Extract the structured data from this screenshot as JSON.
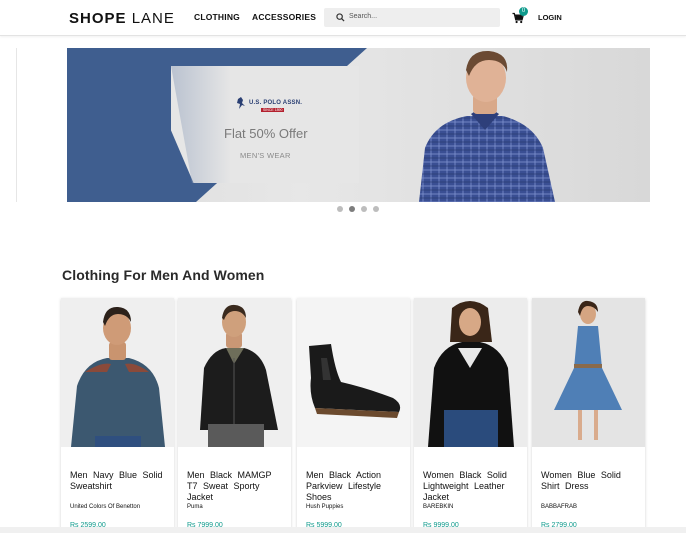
{
  "header": {
    "logo_bold": "SHOPE",
    "logo_light": "LANE",
    "nav": [
      "CLOTHING",
      "ACCESSORIES"
    ],
    "search_placeholder": "Search...",
    "cart_count": "0",
    "login": "LOGIN"
  },
  "banner": {
    "brand": "U.S. POLO ASSN.",
    "brand_since": "SINCE 1890",
    "offer": "Flat 50% Offer",
    "category": "MEN'S WEAR",
    "slides": 4,
    "active_slide": 1
  },
  "section_title": "Clothing For Men And Women",
  "products": [
    {
      "name": "Men Navy Blue Solid Sweatshirt",
      "brand": "United Colors Of Benetton",
      "price": "Rs 2599.00"
    },
    {
      "name": "Men Black MAMGP T7 Sweat Sporty Jacket",
      "brand": "Puma",
      "price": "Rs 7999.00"
    },
    {
      "name": "Men Black Action Parkview Lifestyle Shoes",
      "brand": "Hush Puppies",
      "price": "Rs 5999.00"
    },
    {
      "name": "Women Black Solid Lightweight Leather Jacket",
      "brand": "BAREBKIN",
      "price": "Rs 9999.00"
    },
    {
      "name": "Women Blue Solid Shirt Dress",
      "brand": "BABBAFRAB",
      "price": "Rs 2799.00"
    }
  ],
  "colors": {
    "accent": "#0e9a8c",
    "banner_navy": "#3f5e8f"
  },
  "icons": [
    "search-icon",
    "cart-icon"
  ]
}
